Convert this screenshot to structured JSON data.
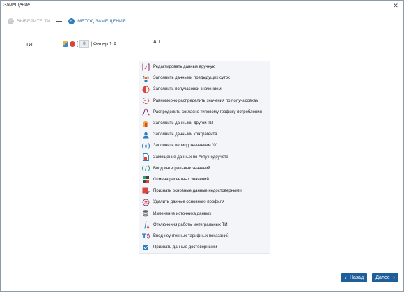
{
  "window": {
    "title": "Замещение",
    "close_glyph": "✕"
  },
  "wizard": {
    "steps": [
      {
        "label": "ВЫБЕРИТЕ ТИ",
        "state": "done"
      },
      {
        "label": "МЕТОД ЗАМЕЩЕНИЯ",
        "state": "active"
      }
    ]
  },
  "ti": {
    "label": "ТИ:",
    "bracket_open": "[",
    "number": "8",
    "name": "] Фидер 1 А",
    "suffix": "АП"
  },
  "methods": [
    {
      "label": "Редактировать данные вручную",
      "icon": "edit-bracket-icon"
    },
    {
      "label": "Заполнить данными предыдущих суток",
      "icon": "sun-previous-day-icon"
    },
    {
      "label": "Заполнить получасовки значением",
      "icon": "half-circle-icon"
    },
    {
      "label": "Равномерно распределить значения по получасовкам",
      "icon": "dotted-circle-icon"
    },
    {
      "label": "Распределить согласно типовому графику потребления",
      "icon": "curve-graph-icon"
    },
    {
      "label": "Заполнить данными другой ТИ",
      "icon": "other-ti-icon"
    },
    {
      "label": "Заполнить данными контрагента",
      "icon": "contractor-icon"
    },
    {
      "label": "Заполнить период значением \"0\"",
      "icon": "zero-value-icon"
    },
    {
      "label": "Замещение данных по Акту недоучета",
      "icon": "act-document-icon"
    },
    {
      "label": "Ввод интегральных значений",
      "icon": "integral-input-icon"
    },
    {
      "label": "Отмена расчетных значений",
      "icon": "cancel-calc-icon"
    },
    {
      "label": "Признать основные данные недостоверными",
      "icon": "invalid-data-icon"
    },
    {
      "label": "Удалить данные основного профиля",
      "icon": "delete-profile-icon"
    },
    {
      "label": "Изменение источника данных",
      "icon": "data-source-icon"
    },
    {
      "label": "Отключения работы интегральных ТИ",
      "icon": "integral-off-icon"
    },
    {
      "label": "Ввод неучтенных тарифных показаний",
      "icon": "tariff-input-icon"
    },
    {
      "label": "Признать данные достоверными",
      "icon": "valid-data-icon"
    }
  ],
  "footer": {
    "back_label": "Назад",
    "next_label": "Далее",
    "back_glyph": "‹",
    "next_glyph": "›"
  },
  "colors": {
    "accent": "#1f5f99",
    "step_active": "#2e7fbf",
    "step_done": "#c8cdd2",
    "menu_bg": "#f3f5f8"
  }
}
